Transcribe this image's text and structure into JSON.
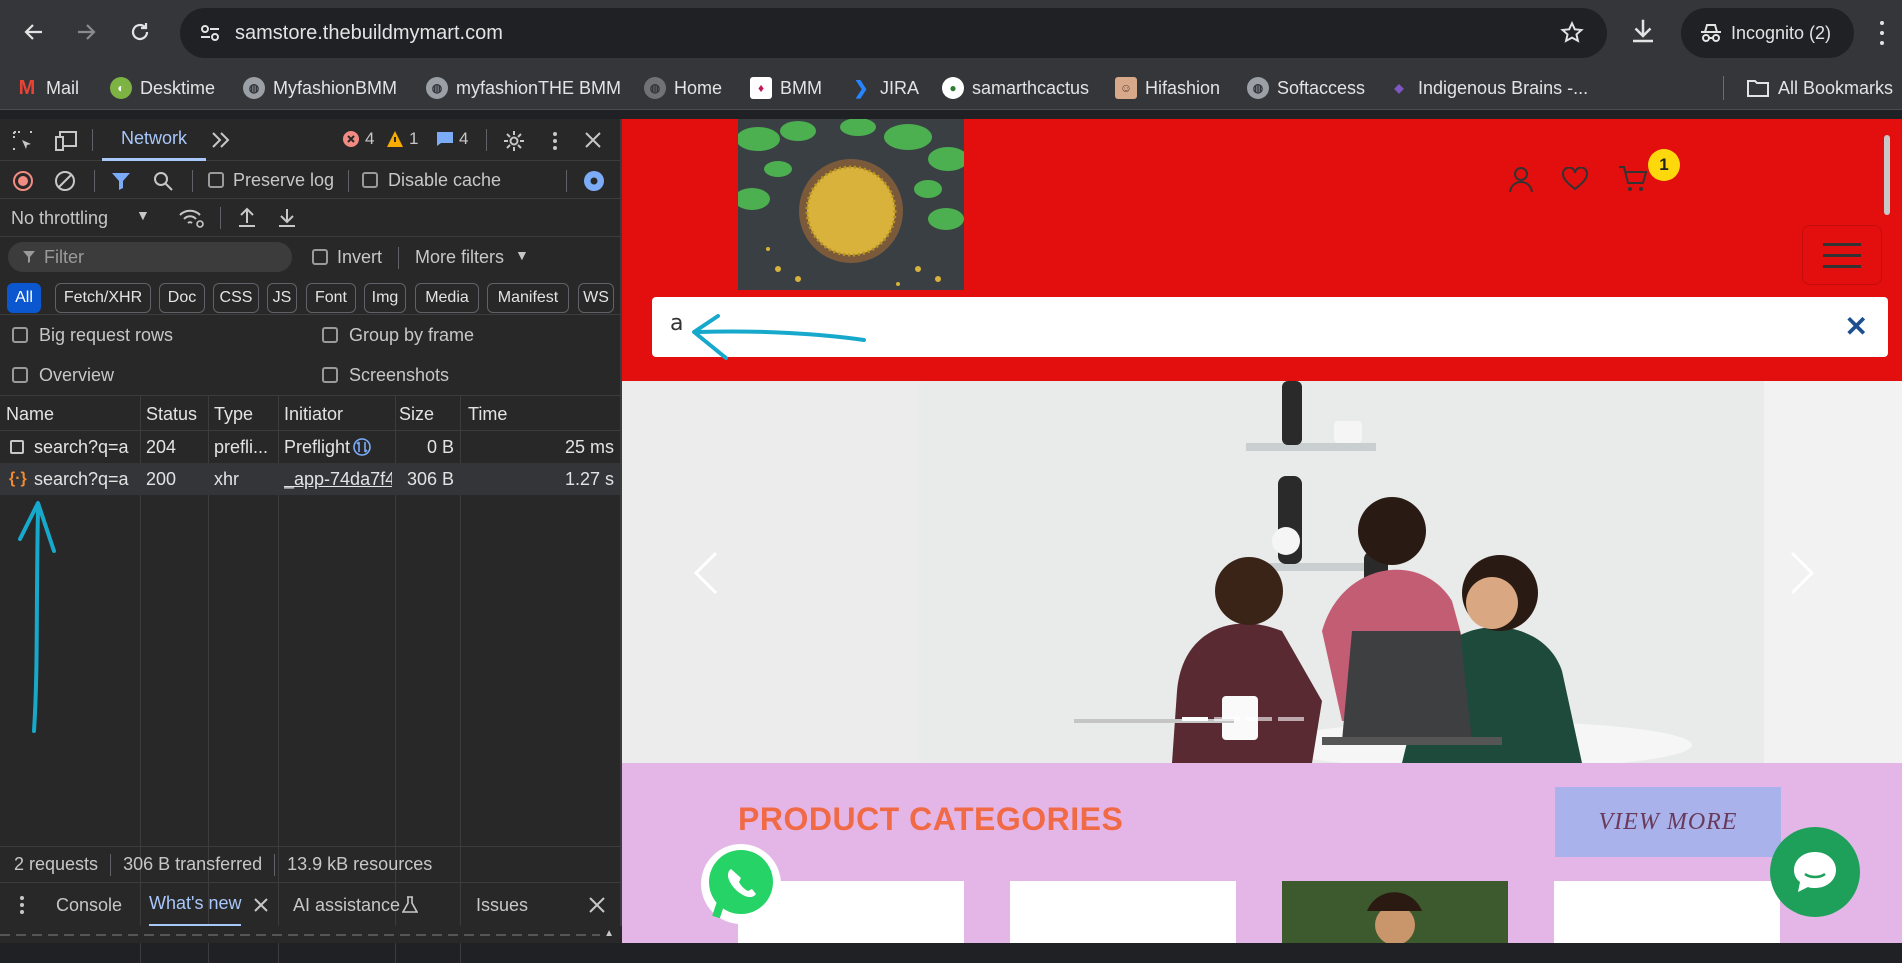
{
  "browser": {
    "url": "samstore.thebuildmymart.com",
    "incognito_label": "Incognito (2)",
    "bookmarks": [
      "Mail",
      "Desktime",
      "MyfashionBMM",
      "myfashionTHE BMM",
      "Home",
      "BMM",
      "JIRA",
      "samarthcactus",
      "Hifashion",
      "Softaccess",
      "Indigenous Brains -..."
    ],
    "all_bookmarks": "All Bookmarks"
  },
  "devtools": {
    "active_tab": "Network",
    "errors": "4",
    "warnings": "1",
    "messages": "4",
    "preserve_log": "Preserve log",
    "disable_cache": "Disable cache",
    "throttling": "No throttling",
    "filter_placeholder": "Filter",
    "invert": "Invert",
    "more_filters": "More filters",
    "chips": [
      "All",
      "Fetch/XHR",
      "Doc",
      "CSS",
      "JS",
      "Font",
      "Img",
      "Media",
      "Manifest",
      "WS"
    ],
    "big_request_rows": "Big request rows",
    "group_by_frame": "Group by frame",
    "overview": "Overview",
    "screenshots": "Screenshots",
    "columns": [
      "Name",
      "Status",
      "Type",
      "Initiator",
      "Size",
      "Time"
    ],
    "rows": [
      {
        "name": "search?q=a",
        "status": "204",
        "type": "prefli...",
        "initiator": "Preflight",
        "size": "0 B",
        "time": "25 ms"
      },
      {
        "name": "search?q=a",
        "status": "200",
        "type": "xhr",
        "initiator": "_app-74da7f4",
        "size": "306 B",
        "time": "1.27 s"
      }
    ],
    "status_requests": "2 requests",
    "status_transferred": "306 B transferred",
    "status_resources": "13.9 kB resources",
    "drawer_tabs": [
      "Console",
      "What's new",
      "AI assistance",
      "Issues"
    ]
  },
  "page": {
    "cart_count": "1",
    "search_value": "a",
    "categories_title": "PRODUCT CATEGORIES",
    "view_more": "VIEW MORE"
  },
  "colors": {
    "header_red": "#e30e0e",
    "section_pink": "#e4b6e7",
    "title_orange": "#f06a45",
    "annotation_cyan": "#17a9cc"
  }
}
